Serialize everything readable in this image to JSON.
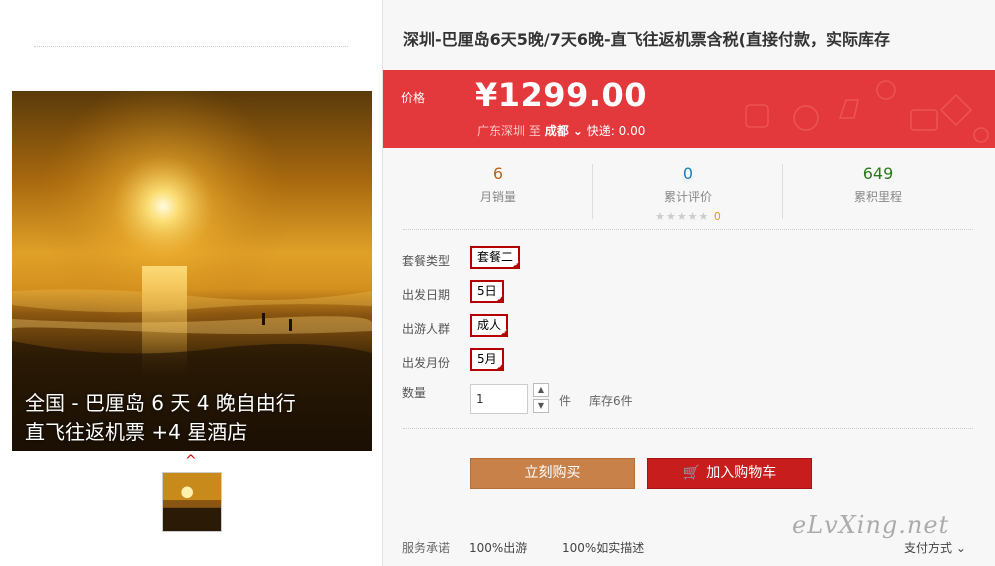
{
  "gallery": {
    "caption_line1": "全国 - 巴厘岛 6 天 4 晚自由行",
    "caption_line2": "直飞往返机票 +4 星酒店",
    "up_icon": "chevron-up-icon"
  },
  "product": {
    "title": "深圳-巴厘岛6天5晚/7天6晚-直飞往返机票含税(直接付款，实际库存"
  },
  "price": {
    "label": "价格",
    "value": "¥1299.00",
    "from": "广东深圳",
    "to_word": "至",
    "dest": "成都",
    "shipping": "快递: 0.00"
  },
  "stats": {
    "monthly_sales_value": "6",
    "monthly_sales_label": "月销量",
    "reviews_value": "0",
    "reviews_label": "累计评价",
    "reviews_count": "0",
    "miles_value": "649",
    "miles_label": "累积里程"
  },
  "options": {
    "package_label": "套餐类型",
    "package_value": "套餐二",
    "date_label": "出发日期",
    "date_value": "5日",
    "crowd_label": "出游人群",
    "crowd_value": "成人",
    "month_label": "出发月份",
    "month_value": "5月"
  },
  "quantity": {
    "label": "数量",
    "value": "1",
    "unit": "件",
    "stock": "库存6件"
  },
  "actions": {
    "buy_label": "立刻购买",
    "cart_label": "加入购物车"
  },
  "service": {
    "label": "服务承诺",
    "item1": "100%出游",
    "item2": "100%如实描述",
    "pay_label": "支付方式"
  },
  "watermark": "eLvXing.net",
  "colors": {
    "price_bg": "#e4393c",
    "buy_btn": "#c9814a",
    "cart_btn": "#c71d1d",
    "sales_num": "#b5651d",
    "review_num": "#1a7dc4",
    "miles_num": "#2a7a1a"
  }
}
